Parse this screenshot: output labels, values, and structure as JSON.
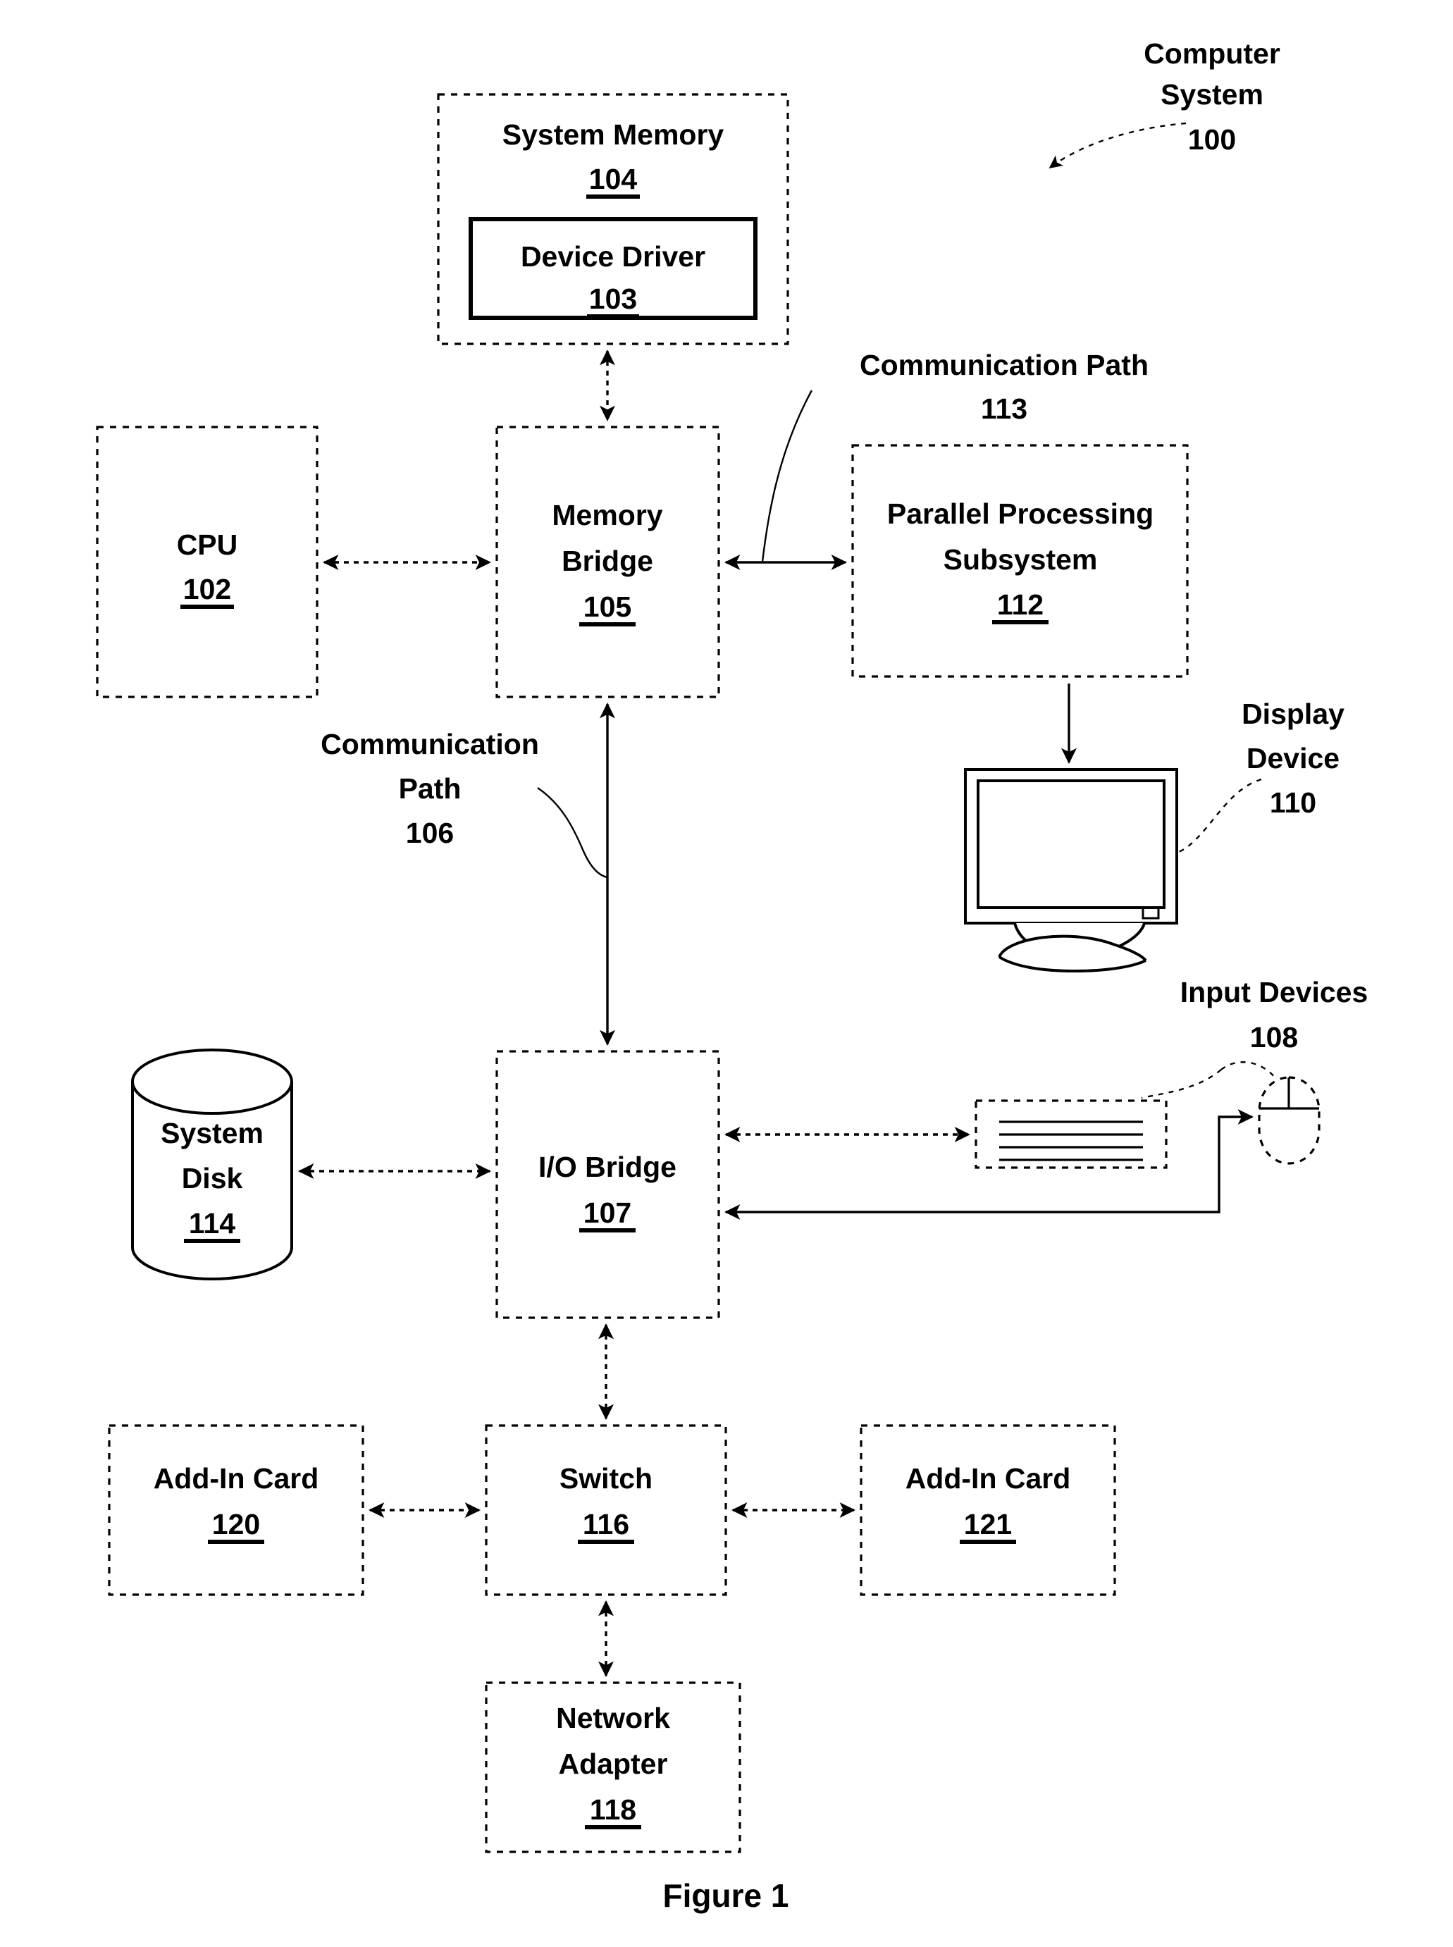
{
  "figure": {
    "caption": "Figure 1",
    "title_callout": {
      "line1": "Computer",
      "line2": "System",
      "ref": "100"
    }
  },
  "blocks": {
    "system_memory": {
      "label": "System Memory",
      "ref": "104"
    },
    "device_driver": {
      "label": "Device Driver",
      "ref": "103"
    },
    "cpu": {
      "label": "CPU",
      "ref": "102"
    },
    "memory_bridge": {
      "line1": "Memory",
      "line2": "Bridge",
      "ref": "105"
    },
    "parallel_processing_subsystem": {
      "line1": "Parallel Processing",
      "line2": "Subsystem",
      "ref": "112"
    },
    "io_bridge": {
      "label": "I/O Bridge",
      "ref": "107"
    },
    "system_disk": {
      "line1": "System",
      "line2": "Disk",
      "ref": "114"
    },
    "switch": {
      "label": "Switch",
      "ref": "116"
    },
    "add_in_card_120": {
      "label": "Add-In Card",
      "ref": "120"
    },
    "add_in_card_121": {
      "label": "Add-In Card",
      "ref": "121"
    },
    "network_adapter": {
      "line1": "Network",
      "line2": "Adapter",
      "ref": "118"
    }
  },
  "callouts": {
    "communication_path_113": {
      "line1": "Communication Path",
      "ref": "113"
    },
    "communication_path_106": {
      "line1": "Communication",
      "line2": "Path",
      "ref": "106"
    },
    "display_device": {
      "line1": "Display",
      "line2": "Device",
      "ref": "110"
    },
    "input_devices": {
      "line1": "Input Devices",
      "ref": "108"
    }
  },
  "colors": {
    "ink": "#000000",
    "paper": "#ffffff"
  }
}
